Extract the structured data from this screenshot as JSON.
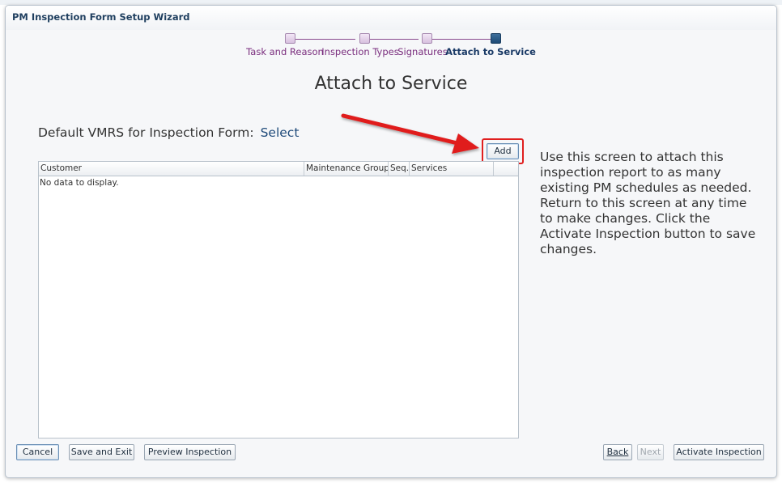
{
  "dialog": {
    "title": "PM Inspection Form Setup Wizard"
  },
  "train": {
    "steps": [
      {
        "label": "Task and Reason",
        "state": "visited"
      },
      {
        "label": "Inspection Types",
        "state": "visited"
      },
      {
        "label": "Signatures",
        "state": "visited"
      },
      {
        "label": "Attach to Service",
        "state": "current"
      }
    ]
  },
  "page": {
    "heading": "Attach to Service"
  },
  "vmrs": {
    "label": "Default VMRS for Inspection Form:",
    "link": "Select"
  },
  "table": {
    "add_label": "Add",
    "columns": [
      "Customer",
      "Maintenance Group",
      "Seq.",
      "Services",
      ""
    ],
    "empty_message": "No data to display."
  },
  "help_text": "Use this screen to attach this inspection report to as many existing PM schedules as needed. Return to this screen at any time to make changes. Click the Activate Inspection button to save changes.",
  "footer": {
    "cancel": "Cancel",
    "save_exit": "Save and Exit",
    "preview": "Preview Inspection",
    "back": "Back",
    "next": "Next",
    "activate": "Activate Inspection"
  },
  "colors": {
    "highlight": "#e01f1f",
    "step_visited": "#7a2e7e",
    "step_current": "#1a3a66"
  }
}
